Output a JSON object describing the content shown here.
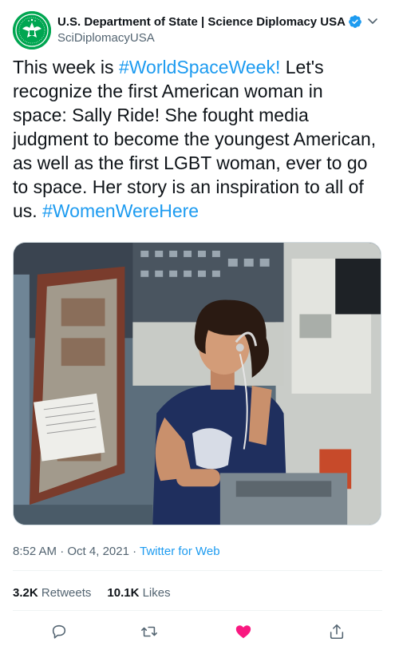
{
  "account": {
    "display_name": "U.S. Department of State | Science Diplomacy USA",
    "handle": "SciDiplomacyUSA",
    "avatar_icon": "state-department-seal-icon",
    "avatar_color": "#00a651"
  },
  "tweet": {
    "text_parts": [
      "This week is ",
      "#WorldSpaceWeek!",
      " Let's recognize the first American woman in space: Sally Ride! She fought media judgment to become the youngest American, as well as the first LGBT woman, ever to go to space. Her story is an inspiration to all of us. ",
      "#WomenWereHere"
    ],
    "hashtag_color": "#1d9bf0"
  },
  "meta": {
    "time": "8:52 AM",
    "sep1": " · ",
    "date": "Oct 4, 2021",
    "sep2": " · ",
    "source": "Twitter for Web"
  },
  "stats": {
    "retweets_count": "3.2K",
    "retweets_label": "Retweets",
    "likes_count": "10.1K",
    "likes_label": "Likes"
  },
  "actions": [
    {
      "icon": "reply-icon"
    },
    {
      "icon": "retweet-icon"
    },
    {
      "icon": "heart-filled-icon",
      "color": "#f91880"
    },
    {
      "icon": "share-icon"
    }
  ]
}
